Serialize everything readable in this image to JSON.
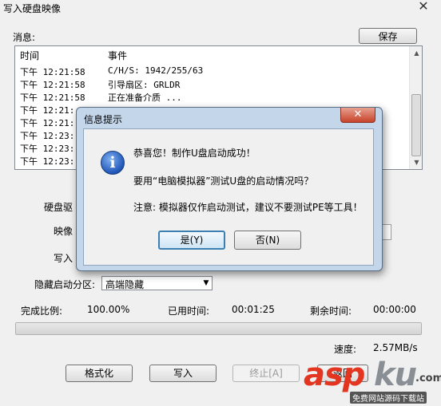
{
  "window": {
    "title": "写入硬盘映像",
    "close_glyph": "✕"
  },
  "messages": {
    "label": "消息:",
    "save_button": "保存",
    "columns": {
      "time": "时间",
      "event": "事件"
    },
    "rows": [
      {
        "time": "下午 12:21:58",
        "event": "C/H/S: 1942/255/63"
      },
      {
        "time": "下午 12:21:58",
        "event": "引导扇区: GRLDR"
      },
      {
        "time": "下午 12:21:58",
        "event": "正在准备介质 ..."
      },
      {
        "time": "下午 12:21:",
        "event": ""
      },
      {
        "time": "下午 12:21:",
        "event": ""
      },
      {
        "time": "下午 12:23:",
        "event": ""
      },
      {
        "time": "下午 12:23:",
        "event": ""
      },
      {
        "time": "下午 12:23:",
        "event": ""
      }
    ]
  },
  "form": {
    "disk_label": "硬盘驱",
    "image_label": "映像",
    "write_label": "写入",
    "hide_partition_label": "隐藏启动分区:",
    "hide_partition_value": "高端隐藏"
  },
  "status": {
    "complete_label": "完成比例:",
    "complete_value": "100.00%",
    "elapsed_label": "已用时间:",
    "elapsed_value": "00:01:25",
    "remaining_label": "剩余时间:",
    "remaining_value": "00:00:00",
    "progress": 1.0,
    "speed_label": "速度:",
    "speed_value": "2.57MB/s"
  },
  "buttons": {
    "format": "格式化",
    "write": "写入",
    "abort": "终止[A]",
    "back": "返回"
  },
  "dialog": {
    "title": "信息提示",
    "close_glyph": "✕",
    "icon": "info-icon",
    "icon_glyph": "i",
    "line1": "恭喜您！制作U盘启动成功！",
    "line2": "要用“电脑模拟器”测试U盘的启动情况吗？",
    "line3": "注意: 模拟器仅作启动测试，建议不要测试PE等工具！",
    "yes": "是(Y)",
    "no": "否(N)"
  },
  "watermark": {
    "brand_a": "asp",
    "brand_b": "ku",
    "suffix": ".com",
    "tagline": "免费网站源码下载站"
  },
  "colors": {
    "dialog_frame": "#c3d6ea",
    "close_red": "#c7432b",
    "watermark_red": "#e33520"
  }
}
